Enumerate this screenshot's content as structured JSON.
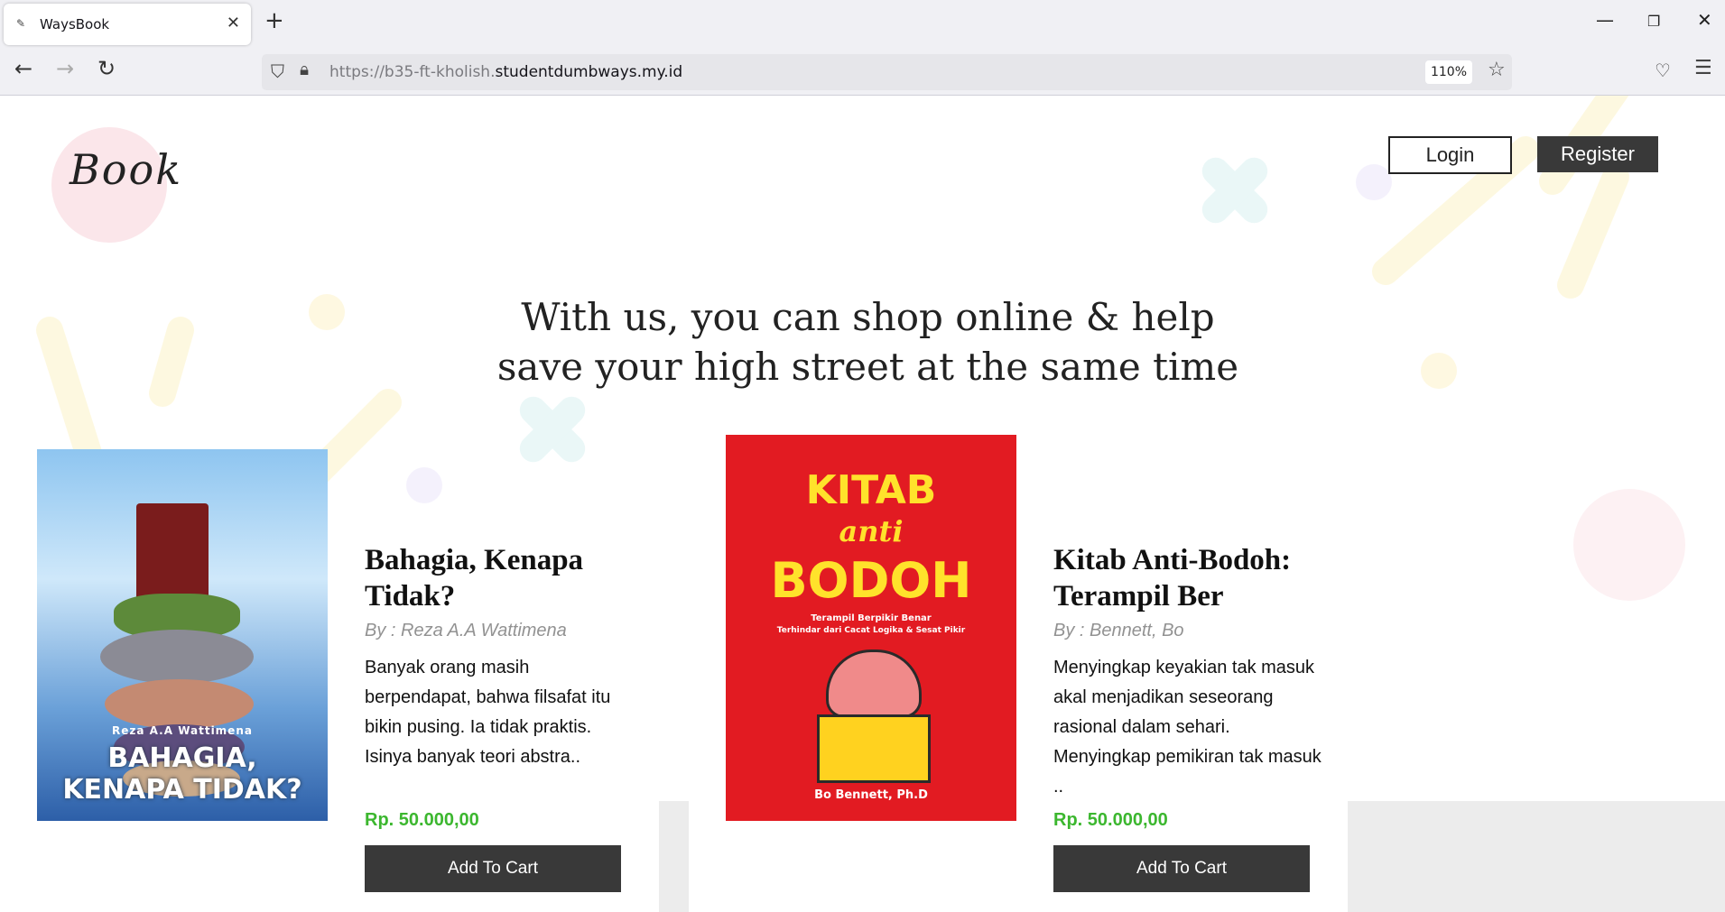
{
  "browser": {
    "tab_title": "WaysBook",
    "favicon": "book-favicon",
    "url_prefix": "https://b35-ft-kholish.",
    "url_host": "studentdumbways.my.id",
    "zoom": "110%"
  },
  "site": {
    "logo_text": "Book",
    "login_label": "Login",
    "register_label": "Register",
    "hero_line1": "With us, you can shop online & help",
    "hero_line2": "save your high street at the same time"
  },
  "books": [
    {
      "title": "Bahagia, Kenapa Tidak?",
      "title_line1": "Bahagia, Kenapa",
      "title_line2": "Tidak?",
      "author": "By : Reza A.A Wattimena",
      "desc": "Banyak orang masih berpendapat, bahwa filsafat itu bikin pusing. Ia tidak praktis. Isinya banyak teori abstra..",
      "price": "Rp. 50.000,00",
      "button": "Add To Cart",
      "cover_text1": "BAHAGIA,",
      "cover_text2": "KENAPA TIDAK?",
      "cover_author": "Reza A.A Wattimena"
    },
    {
      "title": "Kitab Anti-Bodoh: Terampil Ber",
      "title_line1": "Kitab Anti-Bodoh:",
      "title_line2": "Terampil Ber",
      "author": "By : Bennett, Bo",
      "desc": "Menyingkap keyakian tak masuk akal menjadikan seseorang rasional dalam sehari. Menyingkap pemikiran tak masuk ..",
      "price": "Rp. 50.000,00",
      "button": "Add To Cart",
      "cover_text1": "KITAB",
      "cover_text2": "anti",
      "cover_text3": "BODOH",
      "cover_sub1": "Terampil Berpikir Benar",
      "cover_sub2": "Terhindar dari Cacat Logika & Sesat Pikir",
      "cover_author": "Bo Bennett, Ph.D"
    }
  ]
}
